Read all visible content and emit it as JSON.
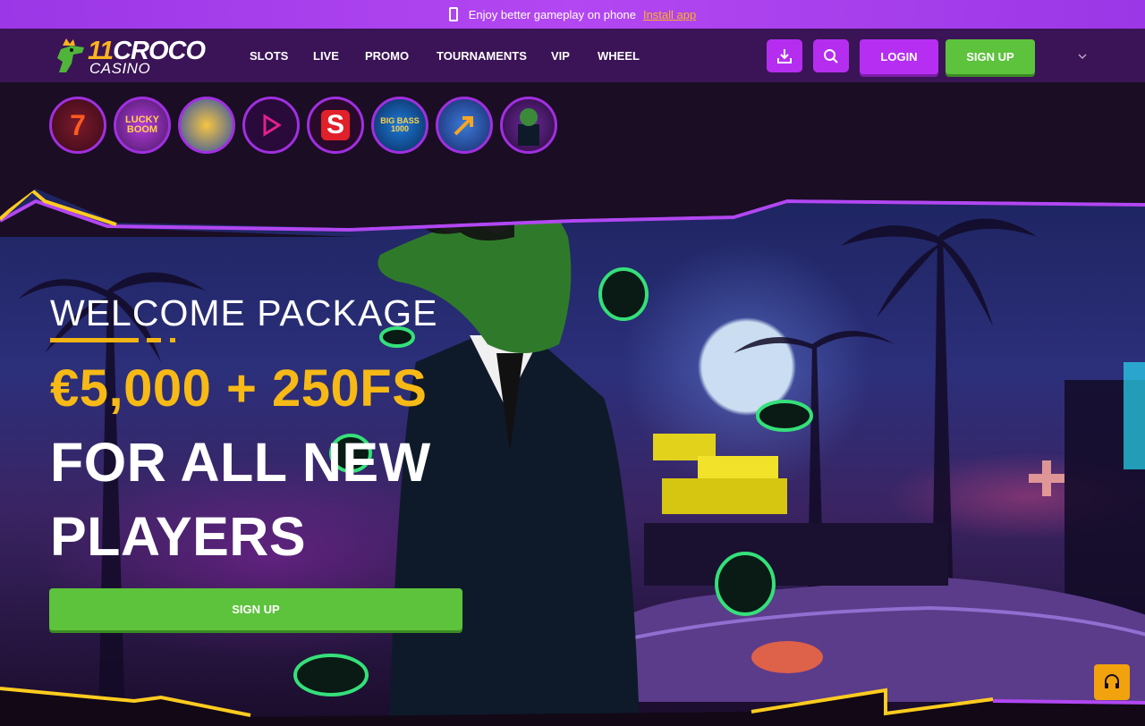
{
  "banner": {
    "text": "Enjoy better gameplay on phone",
    "link": "Install app"
  },
  "logo": {
    "numeral": "11",
    "word": "CROCO",
    "sub": "CASINO"
  },
  "nav": [
    {
      "label": "SLOTS"
    },
    {
      "label": "LIVE"
    },
    {
      "label": "PROMO"
    },
    {
      "label": "TOURNAMENTS"
    },
    {
      "label": "VIP"
    },
    {
      "label": "WHEEL"
    }
  ],
  "header": {
    "login_label": "LOGIN",
    "signup_label": "SIGN UP"
  },
  "quick_games": [
    {
      "icon": "seven-icon",
      "label": "7"
    },
    {
      "icon": "lucky-boom-icon",
      "label": "LUCKY BOOM"
    },
    {
      "icon": "coins-icon",
      "label": ""
    },
    {
      "icon": "play-icon",
      "label": ""
    },
    {
      "icon": "s-logo-icon",
      "label": "S"
    },
    {
      "icon": "big-bass-icon",
      "label": "BIG BASS 1000"
    },
    {
      "icon": "arrow-up-icon",
      "label": ""
    },
    {
      "icon": "croco-avatar-icon",
      "label": ""
    }
  ],
  "hero": {
    "welcome": "WELCOME PACKAGE",
    "amount": "€5,000 + 250FS",
    "line1": "FOR ALL NEW",
    "line2": "PLAYERS",
    "cta": "SIGN UP"
  },
  "colors": {
    "purple": "#b52ef0",
    "green": "#5dc23c",
    "gold": "#f7b915",
    "header": "#3a1456"
  }
}
